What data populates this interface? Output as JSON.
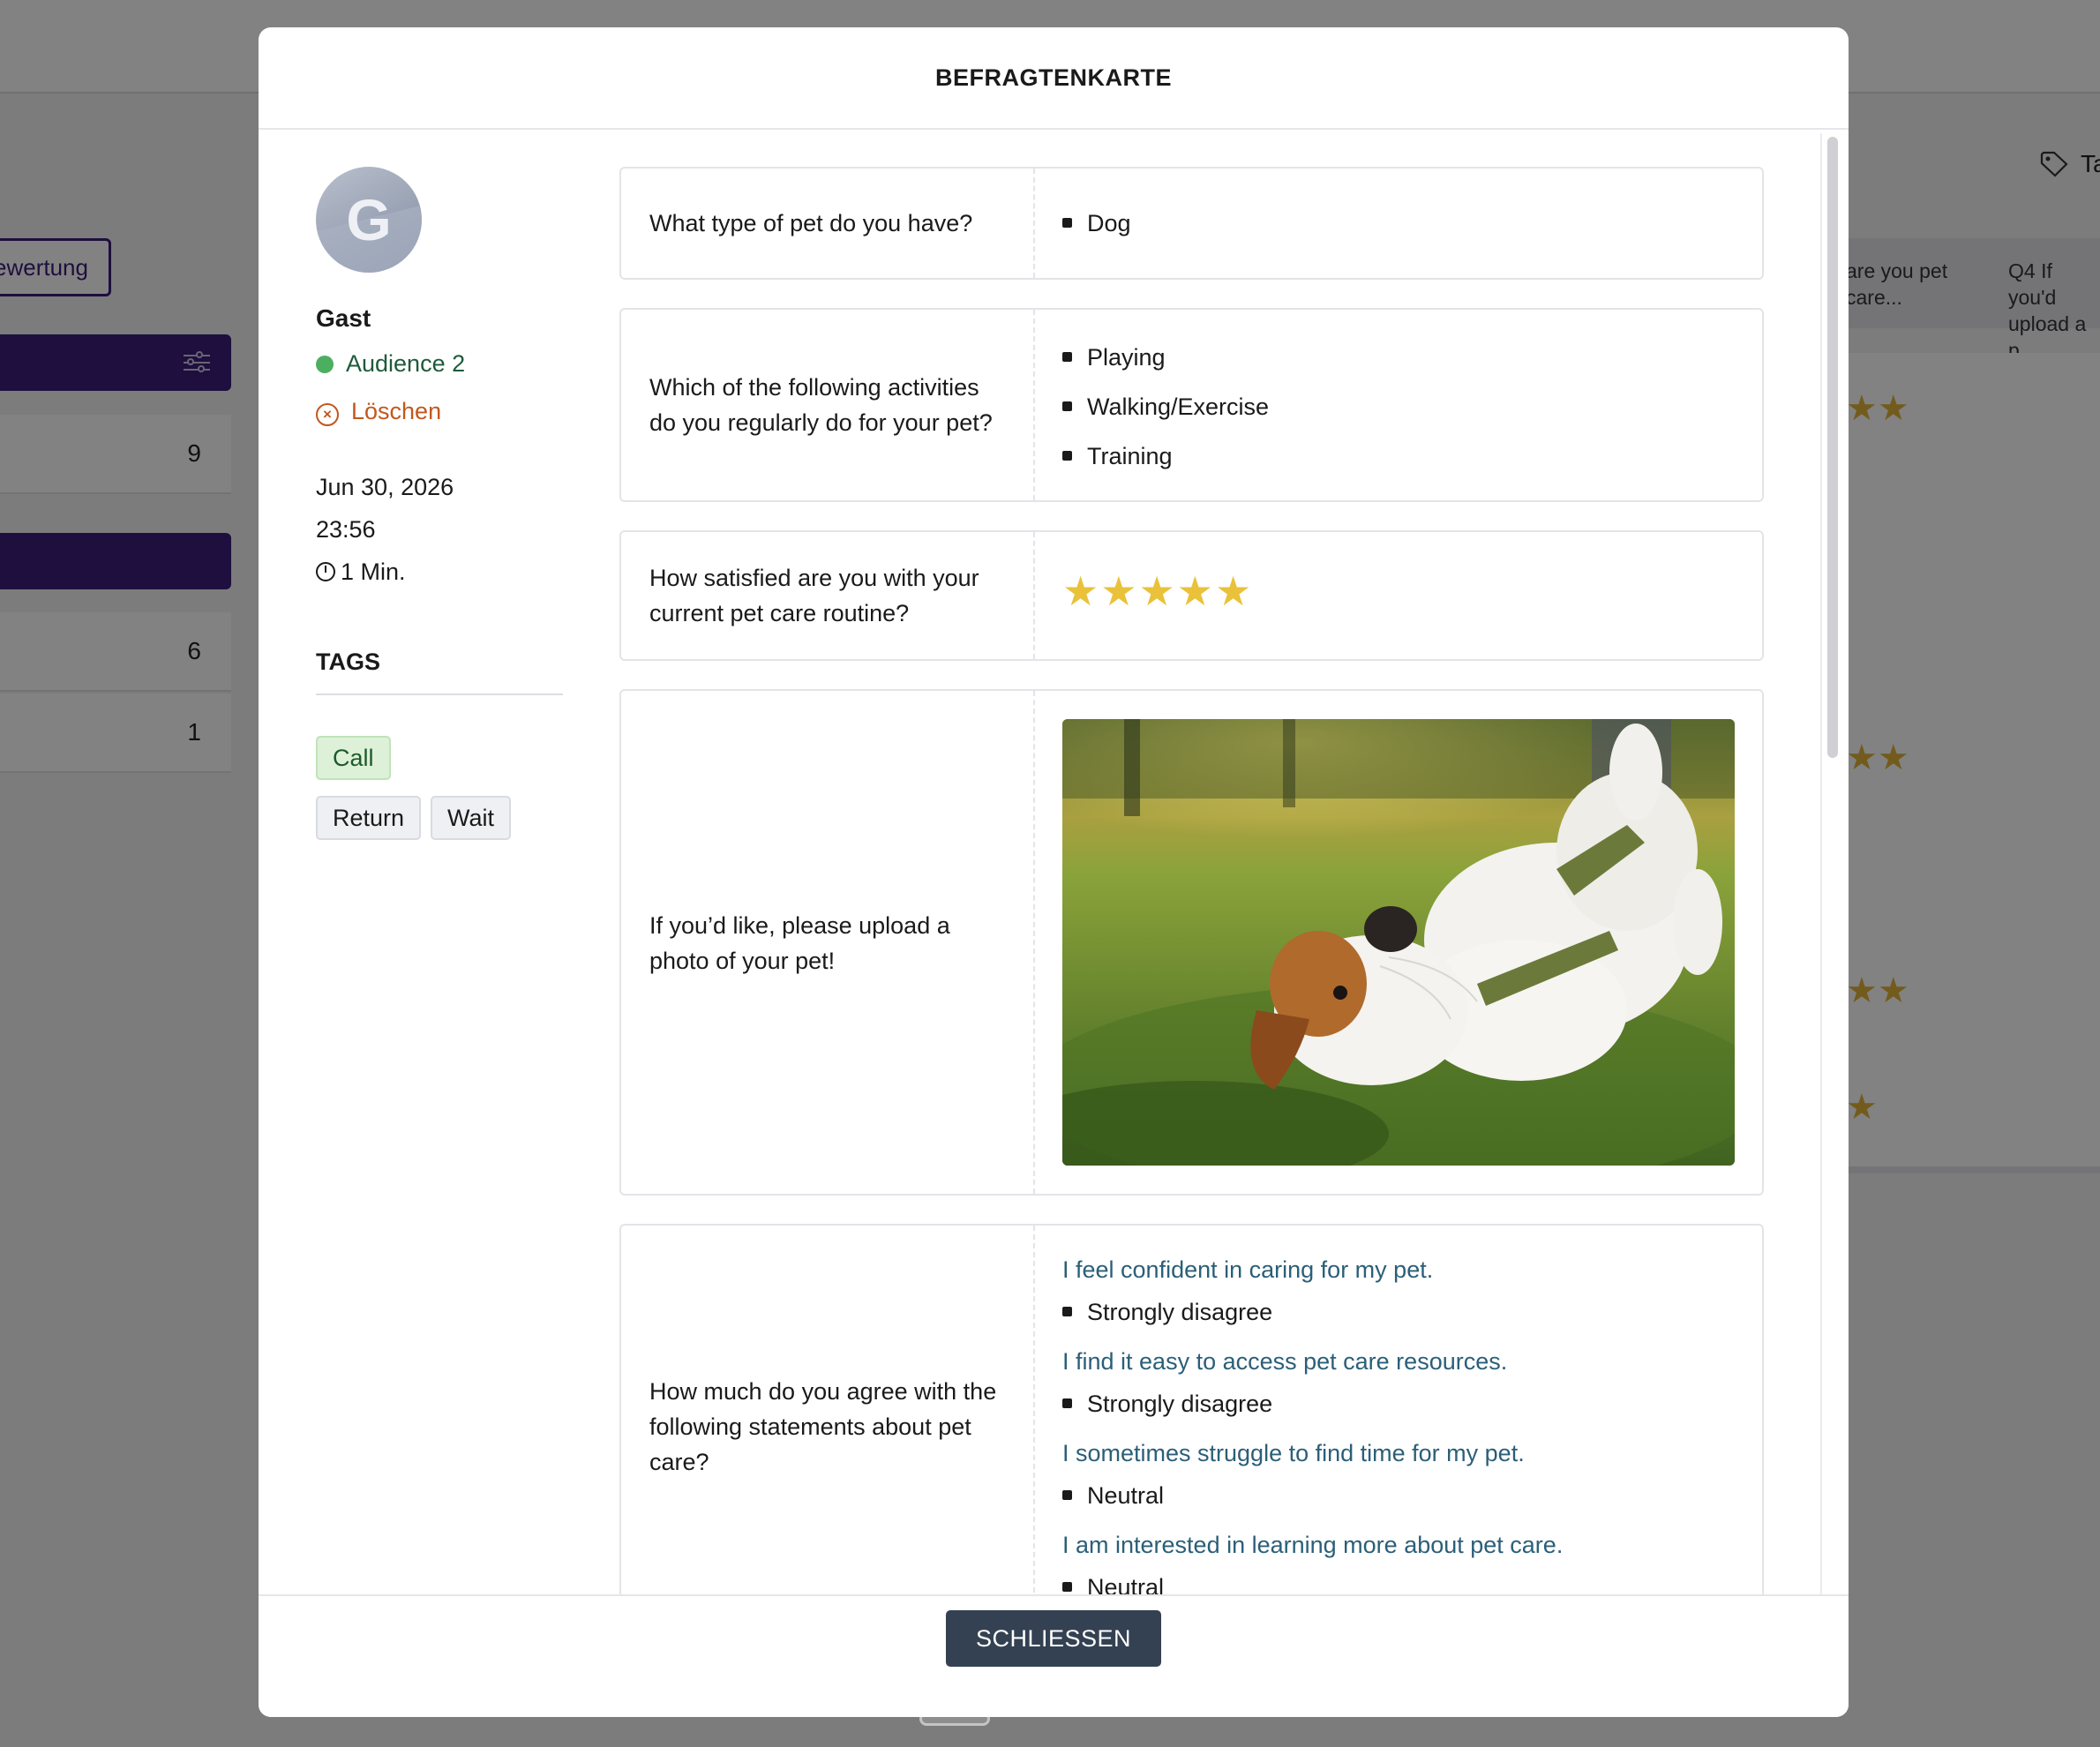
{
  "background": {
    "evaluation_button_label": "ewertung",
    "row_counts": [
      "9",
      "6",
      "1"
    ],
    "right_tag_label": "Ta",
    "right_col1_header": "are you pet care...",
    "right_col2_header": "Q4 If you'd upload a p"
  },
  "modal": {
    "title": "BEFRAGTENKARTE",
    "close_label": "SCHLIESSEN"
  },
  "profile": {
    "avatar_letter": "G",
    "name": "Gast",
    "audience": "Audience 2",
    "delete_label": "Löschen",
    "date": "Jun 30, 2026",
    "time": "23:56",
    "duration": "1 Min.",
    "tags_title": "TAGS",
    "tags": [
      {
        "label": "Call",
        "color": "#ddf1d9"
      },
      {
        "label": "Return",
        "color": "#eef0f3"
      },
      {
        "label": "Wait",
        "color": "#eef0f3"
      }
    ],
    "audience_color": "#4caf60",
    "delete_color": "#c2581e"
  },
  "questions": [
    {
      "question": "What type of pet do you have?",
      "answers": [
        "Dog"
      ]
    },
    {
      "question": "Which of the following activities do you regularly do for your pet?",
      "answers": [
        "Playing",
        "Walking/Exercise",
        "Training"
      ]
    },
    {
      "question": "How satisfied are you with your current pet care routine?",
      "rating": 5,
      "rating_max": 5
    },
    {
      "question": "If you’d like, please upload a photo of your pet!",
      "image": "dog-photo"
    },
    {
      "question": "How much do you agree with the following statements about pet care?",
      "statements": [
        {
          "statement": "I feel confident in caring for my pet.",
          "answer": "Strongly disagree"
        },
        {
          "statement": "I find it easy to access pet care resources.",
          "answer": "Strongly disagree"
        },
        {
          "statement": "I sometimes struggle to find time for my pet.",
          "answer": "Neutral"
        },
        {
          "statement": "I am interested in learning more about pet care.",
          "answer": "Neutral"
        }
      ]
    }
  ],
  "colors": {
    "accent": "#3b1f7a",
    "close_button": "#344152",
    "star": "#e9c23a",
    "statement_text": "#2b5f78"
  },
  "icons": [
    "avatar",
    "x-circle-icon",
    "timer-icon",
    "bullet-icon",
    "star-icon",
    "filter-icon",
    "tag-icon"
  ]
}
